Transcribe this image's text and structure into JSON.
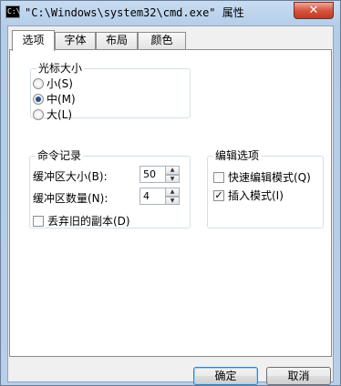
{
  "window": {
    "icon_text": "C:\\",
    "title": "\"C:\\Windows\\system32\\cmd.exe\" 属性",
    "close_glyph": "✕"
  },
  "tabs": [
    {
      "label": "选项",
      "active": true
    },
    {
      "label": "字体",
      "active": false
    },
    {
      "label": "布局",
      "active": false
    },
    {
      "label": "颜色",
      "active": false
    }
  ],
  "cursor_size": {
    "legend": "光标大小",
    "options": [
      {
        "label": "小(S)",
        "checked": false
      },
      {
        "label": "中(M)",
        "checked": true
      },
      {
        "label": "大(L)",
        "checked": false
      }
    ]
  },
  "command_history": {
    "legend": "命令记录",
    "buffer_size_label": "缓冲区大小(B):",
    "buffer_size_value": "50",
    "buffer_count_label": "缓冲区数量(N):",
    "buffer_count_value": "4",
    "discard_label": "丢弃旧的副本(D)",
    "discard_checked": false
  },
  "edit_options": {
    "legend": "编辑选项",
    "quick_edit_label": "快速编辑模式(Q)",
    "quick_edit_checked": false,
    "insert_mode_label": "插入模式(I)",
    "insert_mode_checked": true
  },
  "buttons": {
    "ok": "确定",
    "cancel": "取消"
  },
  "glyphs": {
    "check": "✓",
    "up": "▲",
    "down": "▼"
  }
}
